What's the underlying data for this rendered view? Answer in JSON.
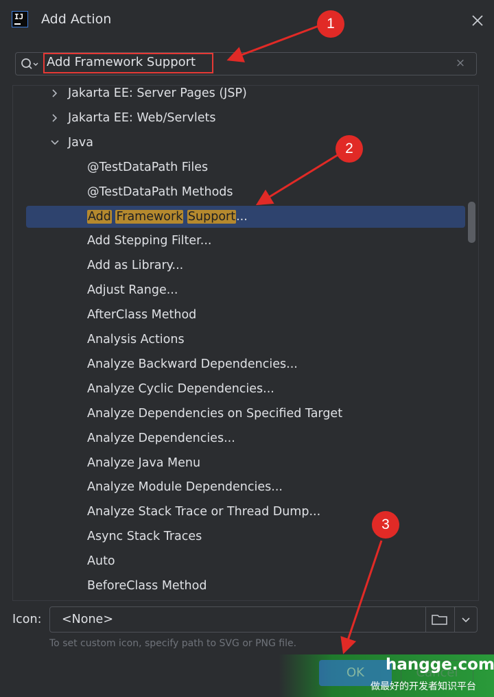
{
  "window": {
    "title": "Add Action"
  },
  "search": {
    "value": "Add Framework Support"
  },
  "tree": {
    "rows": [
      {
        "label": "Jakarta EE: Server Pages (JSP)",
        "expander": "collapsed"
      },
      {
        "label": "Jakarta EE: Web/Servlets",
        "expander": "collapsed"
      },
      {
        "label": "Java",
        "expander": "expanded"
      },
      {
        "label": "@TestDataPath Files"
      },
      {
        "label": "@TestDataPath Methods"
      },
      {
        "label_parts": [
          "Add",
          " ",
          "Framework",
          " ",
          "Support",
          "..."
        ],
        "selected": true
      },
      {
        "label": "Add Stepping Filter..."
      },
      {
        "label": "Add as Library..."
      },
      {
        "label": "Adjust Range..."
      },
      {
        "label": "AfterClass Method"
      },
      {
        "label": "Analysis Actions"
      },
      {
        "label": "Analyze Backward Dependencies..."
      },
      {
        "label": "Analyze Cyclic Dependencies..."
      },
      {
        "label": "Analyze Dependencies on Specified Target"
      },
      {
        "label": "Analyze Dependencies..."
      },
      {
        "label": "Analyze Java Menu"
      },
      {
        "label": "Analyze Module Dependencies..."
      },
      {
        "label": "Analyze Stack Trace or Thread Dump..."
      },
      {
        "label": "Async Stack Traces"
      },
      {
        "label": "Auto"
      },
      {
        "label": "BeforeClass Method"
      }
    ]
  },
  "icon_field": {
    "label": "Icon:",
    "value": "<None>",
    "hint": "To set custom icon, specify path to SVG or PNG file."
  },
  "buttons": {
    "ok": "OK",
    "cancel": "Cancel"
  },
  "watermark": {
    "title": "hangge.com",
    "subtitle": "做最好的开发者知识平台"
  },
  "annotations": {
    "badges": [
      "1",
      "2",
      "3"
    ]
  },
  "colors": {
    "background": "#2b2d30",
    "selection": "#2e436e",
    "match_highlight": "#b5892e",
    "annotation_red": "#e12a26",
    "primary_button": "#3574f0"
  }
}
